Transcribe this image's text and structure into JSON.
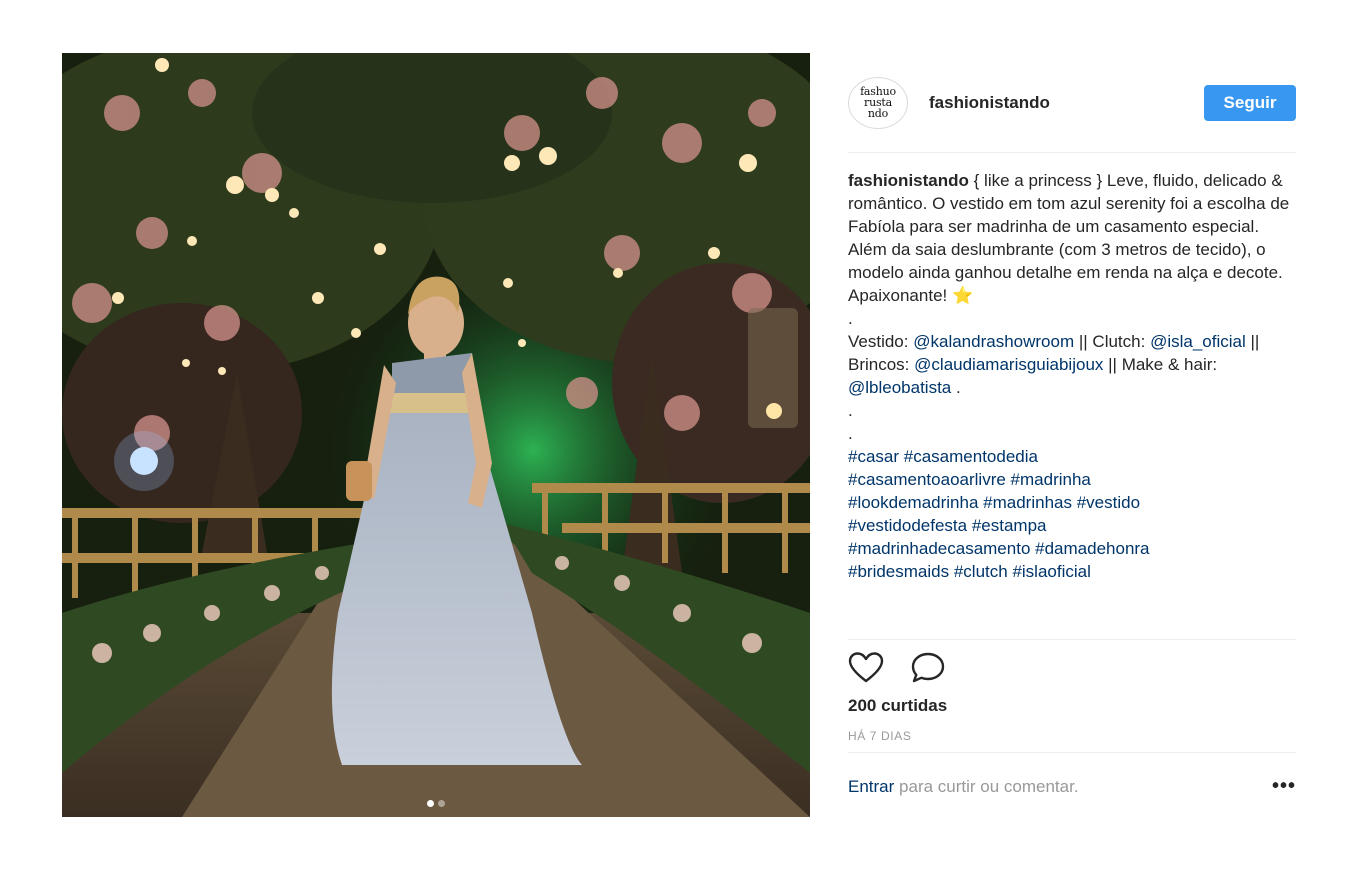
{
  "post": {
    "photo_alt": "Fabíola de vestido azul serenity em um corredor de casamento ao ar livre",
    "carousel": {
      "count": 2,
      "active": 0
    }
  },
  "header": {
    "avatar_text": [
      "fashuo",
      "rusta",
      "ndo"
    ],
    "username": "fashionistando",
    "follow_label": "Seguir"
  },
  "caption": {
    "username": "fashionistando",
    "text": "{ like a princess } Leve, fluido, delicado & romântico. O vestido em tom azul serenity foi a escolha de Fabíola para ser madrinha de um casamento especial. Além da saia deslumbrante (com 3 metros de tecido), o modelo ainda ganhou detalhe em renda na alça e decote. Apaixonante! ⭐",
    "dot1": ".",
    "credits": {
      "vestido_label": "Vestido:",
      "vestido_mention": "@kalandrashowroom",
      "clutch_label": "|| Clutch:",
      "clutch_mention": "@isla_oficial",
      "brincos_label": "|| Brincos:",
      "brincos_mention": "@claudiamarisguiabijoux",
      "make_label": "|| Make & hair:",
      "make_mention": "@lbleobatista",
      "end": "."
    },
    "dot2": ".",
    "dot3": ".",
    "hashtags": [
      "#casar",
      "#casamentodedia",
      "#casamentoaoarlivre",
      "#madrinha",
      "#lookdemadrinha",
      "#madrinhas",
      "#vestido",
      "#vestidodefesta",
      "#estampa",
      "#madrinhadecasamento",
      "#damadehonra",
      "#bridesmaids",
      "#clutch",
      "#islaoficial"
    ]
  },
  "actions": {
    "like_icon": "heart-icon",
    "comment_icon": "comment-icon"
  },
  "likes": "200 curtidas",
  "time_ago": "HÁ 7 DIAS",
  "footer": {
    "login_label": "Entrar",
    "rest": "para curtir ou comentar.",
    "more_label": "•••"
  },
  "colors": {
    "accent": "#3897f0",
    "link": "#003569",
    "muted": "#999999",
    "text": "#262626"
  }
}
